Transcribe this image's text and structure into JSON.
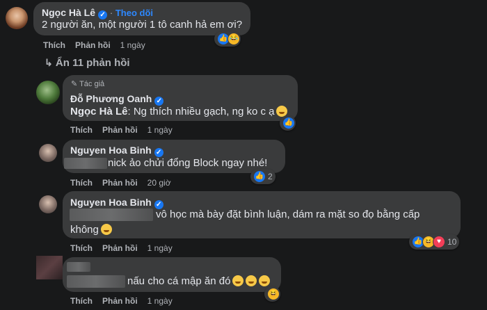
{
  "c1": {
    "name": "Ngọc Hà Lê",
    "follow": "Theo dõi",
    "text": "2 người ăn, một người 1 tô canh hả em ơi?",
    "like": "Thích",
    "reply": "Phản hồi",
    "time": "1 ngày"
  },
  "hide_replies": "Ẩn 11 phản hồi",
  "c2": {
    "author_badge": "Tác giả",
    "name": "Đỗ Phương Oanh",
    "mention": "Ngọc Hà Lê",
    "text": ": Ng thích nhiều gạch, ng ko c ạ",
    "like": "Thích",
    "reply": "Phản hồi",
    "time": "1 ngày"
  },
  "c3": {
    "name": "Nguyen Hoa Binh",
    "text": "nick ảo chửi đổng Block ngay nhé!",
    "like": "Thích",
    "reply": "Phản hồi",
    "time": "20 giờ",
    "reactions": "2"
  },
  "c4": {
    "name": "Nguyen Hoa Binh",
    "text1": "vô học mà bày đặt bình luận, dám ra mặt so đọ bằng cấp",
    "text2": "không",
    "like": "Thích",
    "reply": "Phản hồi",
    "time": "1 ngày",
    "reactions": "10"
  },
  "c5": {
    "text": "nấu cho cá mập ăn đó",
    "like": "Thích",
    "reply": "Phản hồi",
    "time": "1 ngày"
  },
  "colors": {
    "accent": "#1877f2",
    "bubble": "#3a3b3c",
    "bg": "#18191a"
  },
  "icons": [
    "verified-icon",
    "like-reaction-icon",
    "haha-reaction-icon",
    "love-reaction-icon",
    "pencil-icon",
    "reply-arrow-icon"
  ]
}
